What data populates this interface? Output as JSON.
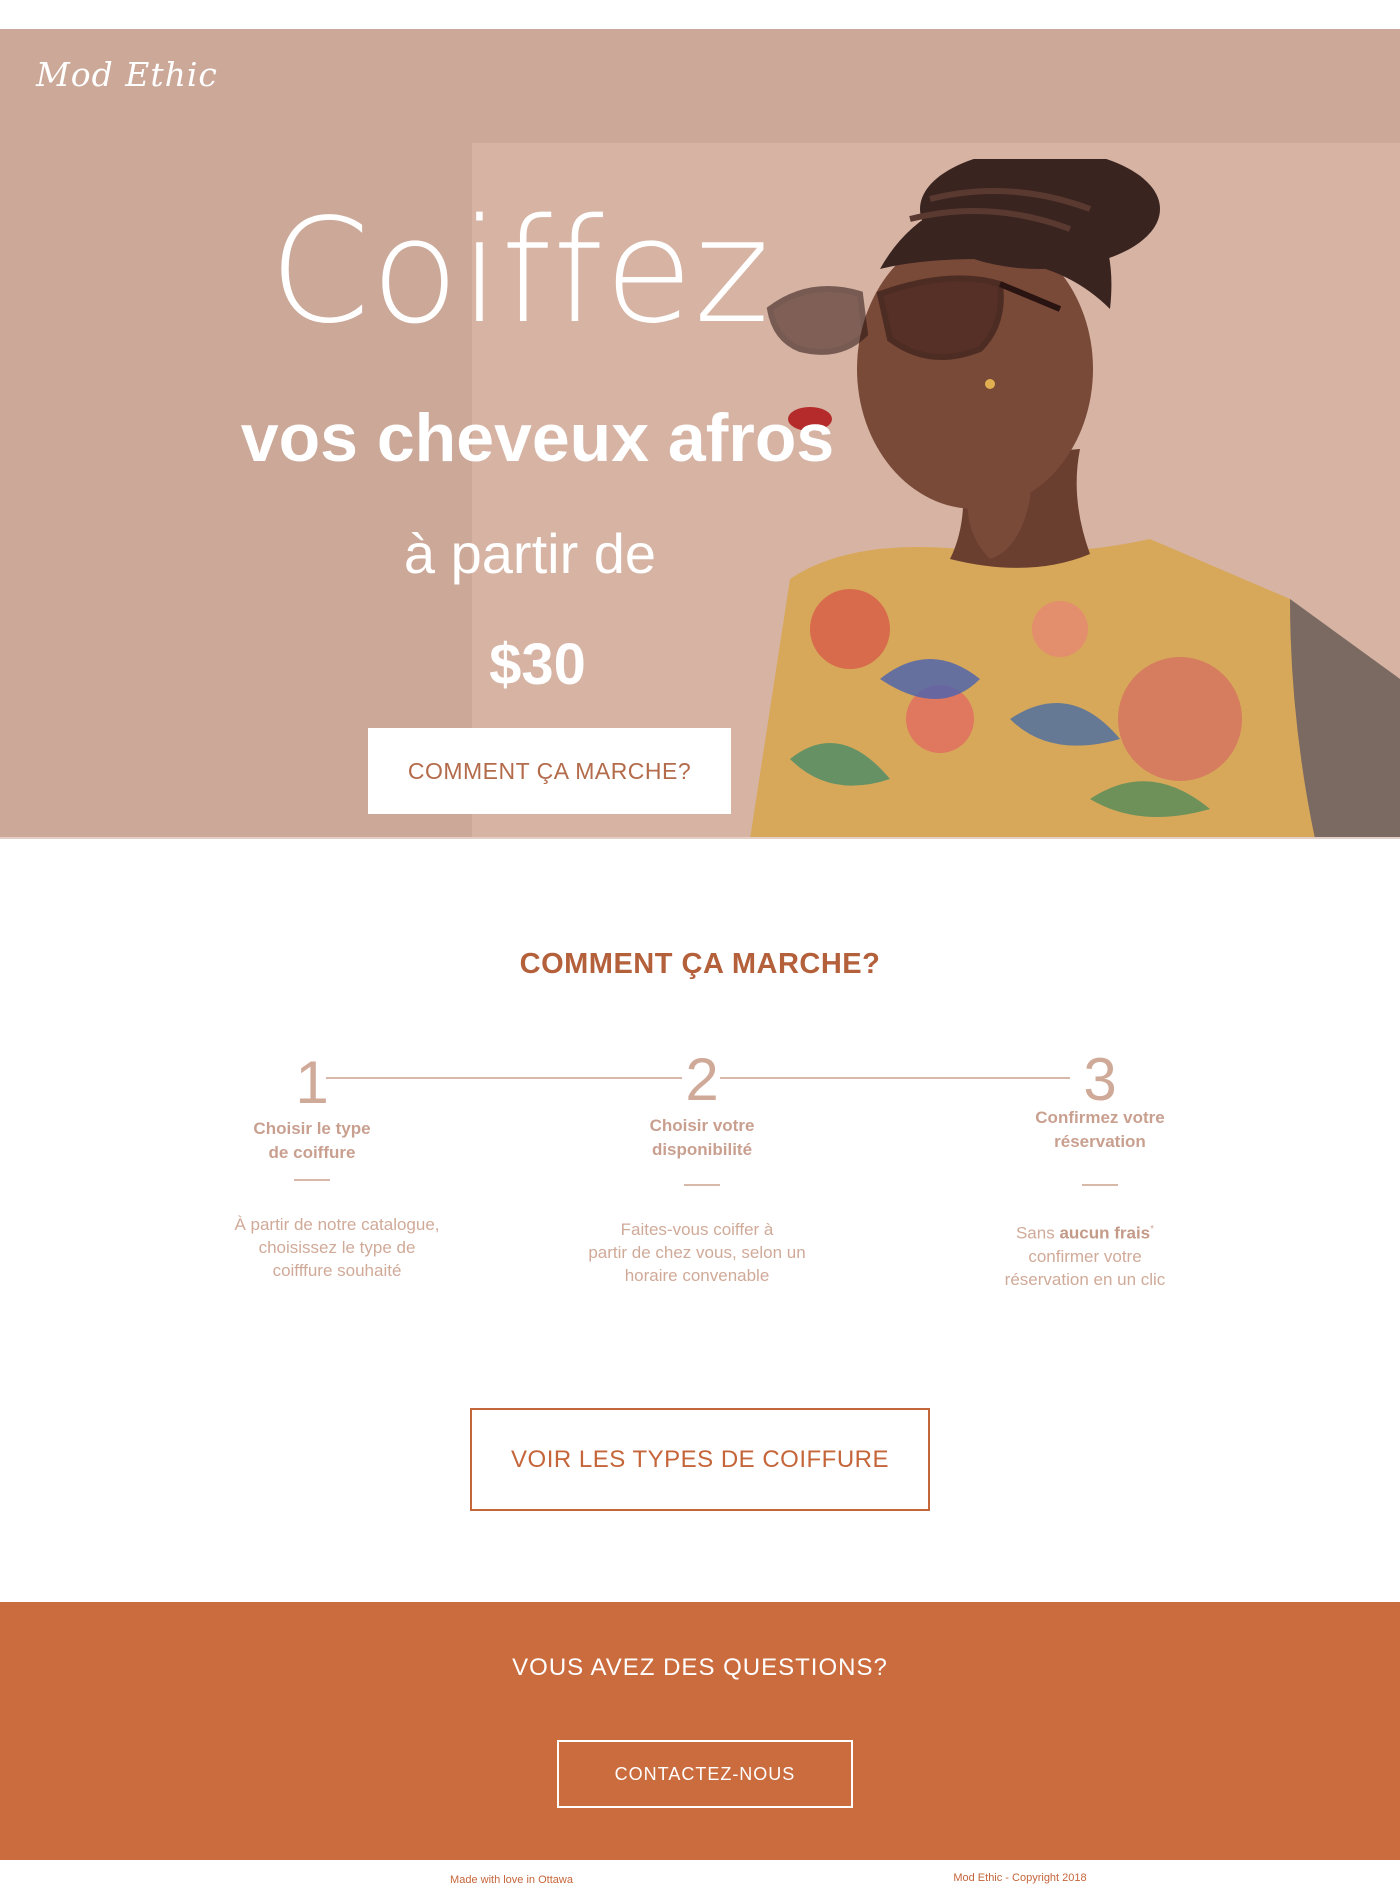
{
  "brand": {
    "logo": "Mod Ethic"
  },
  "hero": {
    "title": "Coiffez",
    "subtitle": "vos cheveux afros",
    "from_label": "à partir de",
    "price": "$30",
    "cta_label": "COMMENT ÇA MARCHE?"
  },
  "how": {
    "title": "COMMENT ÇA MARCHE?",
    "steps": [
      {
        "number": "1",
        "title": "Choisir le type\nde coiffure",
        "desc": "À partir de notre catalogue,\nchoisissez le type de\ncoifffure souhaité"
      },
      {
        "number": "2",
        "title": "Choisir votre\ndisponibilité",
        "desc": "Faites-vous coiffer à\npartir de chez vous, selon un\nhoraire convenable"
      },
      {
        "number": "3",
        "title": "Confirmez votre\nréservation",
        "desc_prefix": "Sans ",
        "desc_bold": "aucun frais",
        "desc_star": "*",
        "desc_rest": "confirmer votre\nréservation en un clic"
      }
    ],
    "types_button": "VOIR LES TYPES DE COIFFURE"
  },
  "questions": {
    "title": "VOUS AVEZ DES QUESTIONS?",
    "contact_button": "CONTACTEZ-NOUS"
  },
  "footer": {
    "left": "Made with love in Ottawa",
    "right": "Mod Ethic - Copyright 2018"
  },
  "colors": {
    "hero_bg": "#cba898",
    "hero_panel": "#d6b3a3",
    "accent": "#c5653a",
    "questions_bg": "#cb6c3e",
    "step_text": "#d0aa98"
  }
}
